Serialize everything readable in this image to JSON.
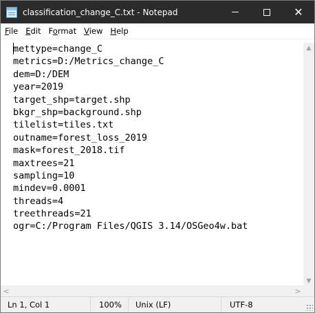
{
  "window": {
    "title": "classification_change_C.txt - Notepad",
    "icon": "notepad-icon",
    "controls": {
      "minimize": "—",
      "maximize": "☐",
      "close": "✕"
    }
  },
  "menubar": {
    "items": [
      {
        "pre": "",
        "mnemonic": "F",
        "post": "ile"
      },
      {
        "pre": "",
        "mnemonic": "E",
        "post": "dit"
      },
      {
        "pre": "F",
        "mnemonic": "o",
        "post": "rmat"
      },
      {
        "pre": "",
        "mnemonic": "V",
        "post": "iew"
      },
      {
        "pre": "",
        "mnemonic": "H",
        "post": "elp"
      }
    ]
  },
  "editor": {
    "lines": [
      "mettype=change_C",
      "metrics=D:/Metrics_change_C",
      "dem=D:/DEM",
      "year=2019",
      "target_shp=target.shp",
      "bkgr_shp=background.shp",
      "tilelist=tiles.txt",
      "outname=forest_loss_2019",
      "mask=forest_2018.tif",
      "maxtrees=21",
      "sampling=10",
      "mindev=0.0001",
      "threads=4",
      "treethreads=21",
      "ogr=C:/Program Files/QGIS 3.14/OSGeo4w.bat"
    ]
  },
  "statusbar": {
    "position": "Ln 1, Col 1",
    "zoom": "100%",
    "line_endings": "Unix (LF)",
    "encoding": "UTF-8"
  },
  "colors": {
    "titlebar_bg": "#2b2b2b",
    "chrome_bg": "#f0f0f0"
  }
}
